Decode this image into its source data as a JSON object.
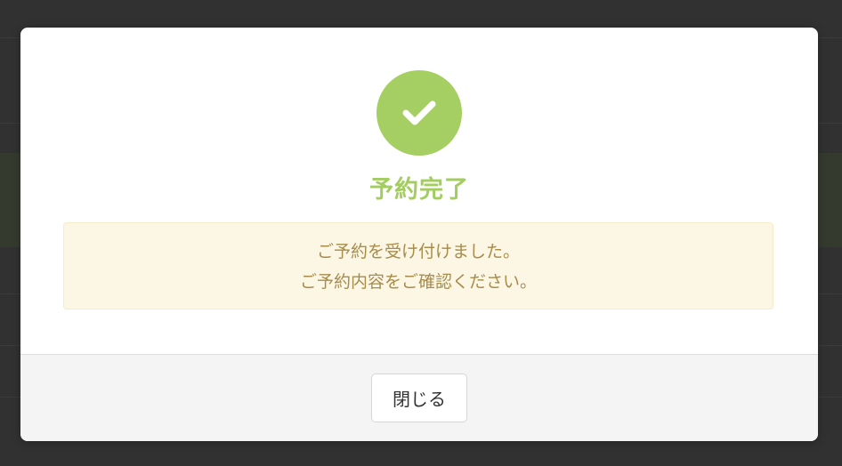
{
  "modal": {
    "title": "予約完了",
    "message": {
      "line1": "ご予約を受け付けました。",
      "line2": "ご予約内容をご確認ください。"
    },
    "icon": "check-circle-icon",
    "close_label": "閉じる"
  },
  "colors": {
    "success": "#a6cf63",
    "title": "#a3cd5e",
    "message_bg": "#fbf7e4",
    "message_text": "#a78c4c",
    "footer_bg": "#f4f4f4",
    "backdrop": "#313131"
  }
}
